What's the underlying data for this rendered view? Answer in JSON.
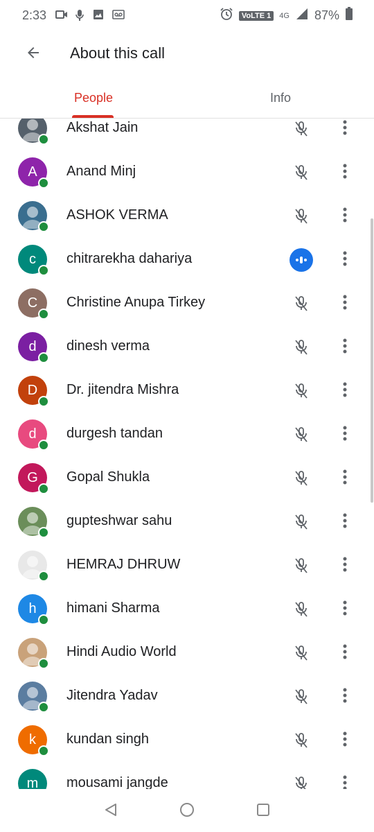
{
  "status_bar": {
    "time": "2:33",
    "network_label": "VoLTE 1",
    "network_type": "4G",
    "battery": "87%"
  },
  "header": {
    "title": "About this call",
    "back_icon": "arrow-left-icon"
  },
  "tabs": [
    {
      "label": "People",
      "selected": true
    },
    {
      "label": "Info",
      "selected": false
    }
  ],
  "colors": {
    "accent": "#d93025",
    "presence": "#1e8e3e",
    "speaking": "#1a73e8"
  },
  "participants": [
    {
      "name": "Akshat Jain",
      "avatar_letter": "",
      "avatar_color": "#55606b",
      "photo": true,
      "muted": true
    },
    {
      "name": "Anand Minj",
      "avatar_letter": "A",
      "avatar_color": "#8e24aa",
      "photo": false,
      "muted": true
    },
    {
      "name": "ASHOK VERMA",
      "avatar_letter": "",
      "avatar_color": "#3a6e8f",
      "photo": true,
      "muted": true
    },
    {
      "name": "chitrarekha dahariya",
      "avatar_letter": "c",
      "avatar_color": "#00897b",
      "photo": false,
      "muted": false
    },
    {
      "name": "Christine Anupa Tirkey",
      "avatar_letter": "C",
      "avatar_color": "#8d6e63",
      "photo": false,
      "muted": true
    },
    {
      "name": "dinesh verma",
      "avatar_letter": "d",
      "avatar_color": "#7b1fa2",
      "photo": false,
      "muted": true
    },
    {
      "name": "Dr. jitendra Mishra",
      "avatar_letter": "D",
      "avatar_color": "#c2410c",
      "photo": false,
      "muted": true
    },
    {
      "name": "durgesh tandan",
      "avatar_letter": "d",
      "avatar_color": "#e84a7f",
      "photo": false,
      "muted": true
    },
    {
      "name": "Gopal Shukla",
      "avatar_letter": "G",
      "avatar_color": "#c2185b",
      "photo": false,
      "muted": true
    },
    {
      "name": "gupteshwar sahu",
      "avatar_letter": "",
      "avatar_color": "#6b8e5a",
      "photo": true,
      "muted": true
    },
    {
      "name": "HEMRAJ DHRUW",
      "avatar_letter": "",
      "avatar_color": "#e8e8e8",
      "photo": true,
      "muted": true
    },
    {
      "name": "himani Sharma",
      "avatar_letter": "h",
      "avatar_color": "#1e88e5",
      "photo": false,
      "muted": true
    },
    {
      "name": "Hindi Audio World",
      "avatar_letter": "",
      "avatar_color": "#c9a27a",
      "photo": true,
      "muted": true
    },
    {
      "name": "Jitendra Yadav",
      "avatar_letter": "",
      "avatar_color": "#5b7da0",
      "photo": true,
      "muted": true
    },
    {
      "name": "kundan singh",
      "avatar_letter": "k",
      "avatar_color": "#ef6c00",
      "photo": false,
      "muted": true
    },
    {
      "name": "mousami jangde",
      "avatar_letter": "m",
      "avatar_color": "#00897b",
      "photo": false,
      "muted": true
    }
  ],
  "nav_bar": [
    "back-triangle-icon",
    "home-circle-icon",
    "recents-square-icon"
  ]
}
